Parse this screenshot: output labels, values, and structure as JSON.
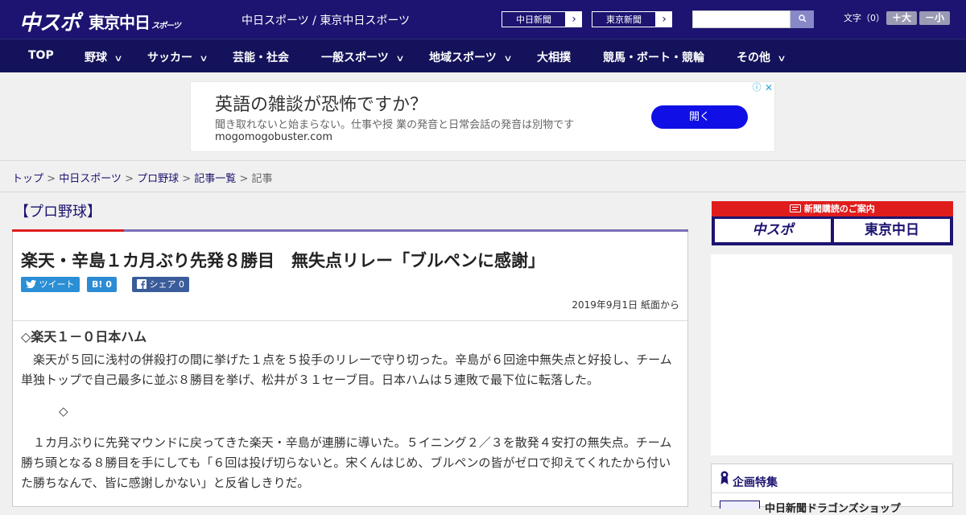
{
  "header": {
    "logo_chuspo": "中スポ",
    "logo_tokyo": "東京中日",
    "logo_tokyo_suffix": "スポーツ",
    "site_title": "中日スポーツ / 東京中日スポーツ",
    "ext_links": [
      {
        "label": "中日新聞"
      },
      {
        "label": "東京新聞"
      }
    ],
    "search_placeholder": "",
    "font_size_label": "文字（0）",
    "font_bigger": "＋大",
    "font_smaller": "－小"
  },
  "nav": {
    "items": [
      {
        "label": "TOP",
        "dropdown": false
      },
      {
        "label": "野球",
        "dropdown": true
      },
      {
        "label": "サッカー",
        "dropdown": true
      },
      {
        "label": "芸能・社会",
        "dropdown": false
      },
      {
        "label": "一般スポーツ",
        "dropdown": true
      },
      {
        "label": "地域スポーツ",
        "dropdown": true
      },
      {
        "label": "大相撲",
        "dropdown": false
      },
      {
        "label": "競馬・ボート・競輪",
        "dropdown": false
      },
      {
        "label": "その他",
        "dropdown": true
      }
    ]
  },
  "ad": {
    "headline": "英語の雑談が恐怖ですか？",
    "sub": "聞き取れないと始まらない。仕事や授 業の発音と日常会話の発音は別物です",
    "domain": "mogomogobuster.com",
    "cta": "開く",
    "info_icon": "ⓘ",
    "close_icon": "✕"
  },
  "breadcrumb": {
    "items": [
      "トップ",
      "中日スポーツ",
      "プロ野球",
      "記事一覧"
    ],
    "current": "記事",
    "sep": " > "
  },
  "article": {
    "category": "【プロ野球】",
    "title": "楽天・辛島１カ月ぶり先発８勝目　無失点リレー「ブルペンに感謝」",
    "share_tweet": "ツイート",
    "share_hatena": "B! 0",
    "share_facebook": "シェア 0",
    "date": "2019年9月1日 紙面から",
    "subhead": "◇楽天１－０日本ハム",
    "para1": "　楽天が５回に浅村の併殺打の間に挙げた１点を５投手のリレーで守り切った。辛島が６回途中無失点と好投し、チーム単独トップで自己最多に並ぶ８勝目を挙げ、松井が３１セーブ目。日本ハムは５連敗で最下位に転落した。",
    "diamond": "◇",
    "para2": "　１カ月ぶりに先発マウンドに戻ってきた楽天・辛島が連勝に導いた。５イニング２／３を散発４安打の無失点。チーム勝ち頭となる８勝目を手にしても「６回は投げ切らないと。宋くんはじめ、ブルペンの皆がゼロで抑えてくれたから付いた勝ちなんで、皆に感謝しかない」と反省しきりだ。"
  },
  "sidebar": {
    "subscribe_head": "新聞購読のご案内",
    "subscribe_logo1": "中スポ",
    "subscribe_logo2": "東京中日",
    "feature_title": "企画特集",
    "feature_item": "中日新聞ドラゴンズショップ"
  },
  "colors": {
    "brand": "#1c1470",
    "nav": "#13125a",
    "accent_red": "#e01d1d",
    "ad_button": "#1010e6"
  }
}
